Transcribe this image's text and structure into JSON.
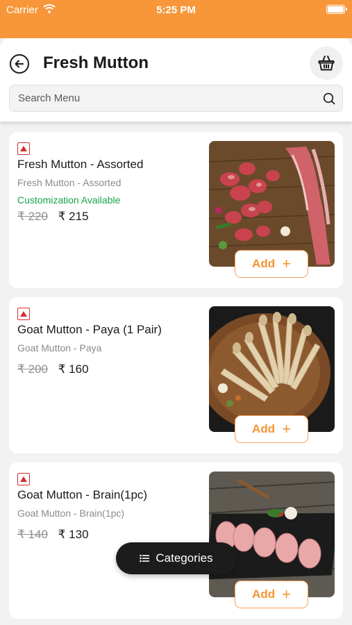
{
  "status_bar": {
    "carrier": "Carrier",
    "time": "5:25 PM"
  },
  "header": {
    "title": "Fresh Mutton"
  },
  "search": {
    "placeholder": "Search Menu"
  },
  "items": [
    {
      "name": "Fresh Mutton - Assorted",
      "description": "Fresh Mutton - Assorted",
      "customization": "Customization Available",
      "old_price": "₹ 220",
      "new_price": "₹ 215",
      "add_label": "Add",
      "add_icon": "+",
      "image_icon": "mutton-assorted-image"
    },
    {
      "name": "Goat Mutton - Paya (1 Pair)",
      "description": "Goat Mutton - Paya",
      "old_price": "₹ 200",
      "new_price": "₹ 160",
      "add_label": "Add",
      "add_icon": "+",
      "image_icon": "mutton-paya-image"
    },
    {
      "name": "Goat Mutton - Brain(1pc)",
      "description": "Goat Mutton - Brain(1pc)",
      "old_price": "₹ 140",
      "new_price": "₹ 130",
      "add_label": "Add",
      "add_icon": "+",
      "image_icon": "mutton-brain-image"
    }
  ],
  "categories_button": {
    "label": "Categories",
    "icon": "list-icon"
  },
  "colors": {
    "brand_orange": "#f7973a",
    "accent_orange": "#f39431",
    "green": "#17a24a",
    "nonveg_red": "#d32f2f"
  }
}
